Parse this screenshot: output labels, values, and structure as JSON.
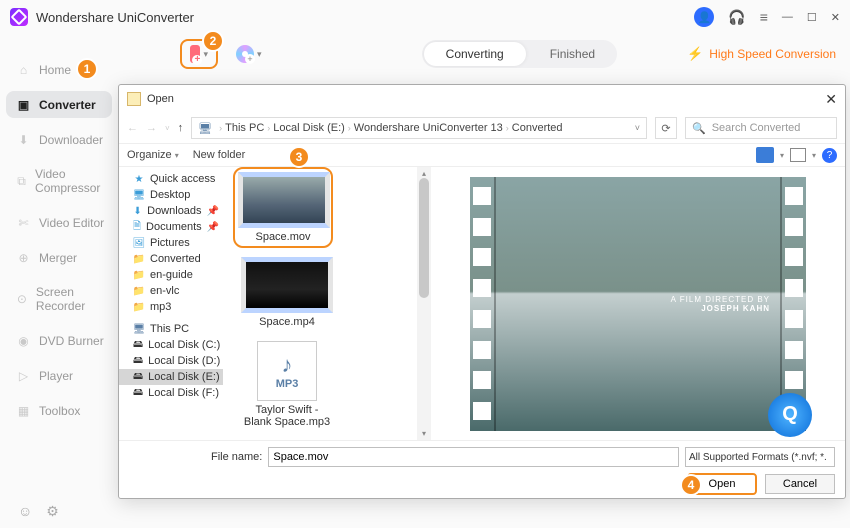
{
  "app": {
    "title": "Wondershare UniConverter"
  },
  "sidebar": {
    "items": [
      {
        "label": "Home"
      },
      {
        "label": "Converter"
      },
      {
        "label": "Downloader"
      },
      {
        "label": "Video Compressor"
      },
      {
        "label": "Video Editor"
      },
      {
        "label": "Merger"
      },
      {
        "label": "Screen Recorder"
      },
      {
        "label": "DVD Burner"
      },
      {
        "label": "Player"
      },
      {
        "label": "Toolbox"
      }
    ]
  },
  "tabs": {
    "converting": "Converting",
    "finished": "Finished"
  },
  "highspeed": "High Speed Conversion",
  "callouts": {
    "c1": "1",
    "c2": "2",
    "c3": "3",
    "c4": "4"
  },
  "dialog": {
    "title": "Open",
    "path": {
      "p0": "This PC",
      "p1": "Local Disk (E:)",
      "p2": "Wondershare UniConverter 13",
      "p3": "Converted"
    },
    "search_placeholder": "Search Converted",
    "organize": "Organize",
    "new_folder": "New folder",
    "tree": {
      "quick": "Quick access",
      "desktop": "Desktop",
      "downloads": "Downloads",
      "documents": "Documents",
      "pictures": "Pictures",
      "converted": "Converted",
      "enguide": "en-guide",
      "envlc": "en-vlc",
      "mp3": "mp3",
      "thispc": "This PC",
      "diskc": "Local Disk (C:)",
      "diskd": "Local Disk (D:)",
      "diske": "Local Disk (E:)",
      "diskf": "Local Disk (F:)"
    },
    "files": {
      "f1": "Space.mov",
      "f2": "Space.mp4",
      "f3_l1": "Taylor Swift -",
      "f3_l2": "Blank Space.mp3",
      "mp3label": "MP3"
    },
    "preview": {
      "line1": "A FILM DIRECTED BY",
      "line2": "JOSEPH KAHN"
    },
    "filename_label": "File name:",
    "filename_value": "Space.mov",
    "format": "All Supported Formats (*.nvf; *.",
    "open": "Open",
    "cancel": "Cancel"
  }
}
